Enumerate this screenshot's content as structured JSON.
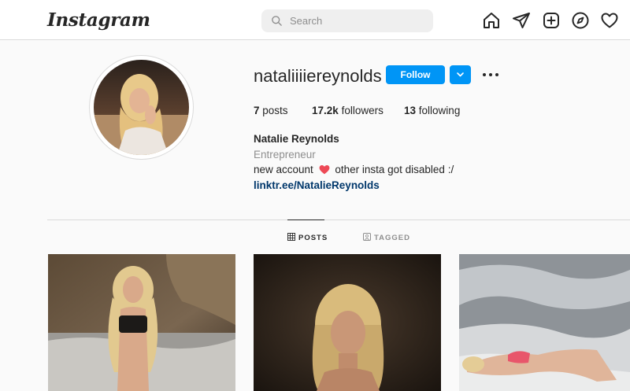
{
  "header": {
    "logo": "Instagram",
    "search_placeholder": "Search",
    "nav_icons": [
      "home-icon",
      "direct-message-icon",
      "new-post-icon",
      "explore-icon",
      "activity-heart-icon"
    ]
  },
  "profile": {
    "username": "nataliiiiereynolds",
    "follow_label": "Follow",
    "stats": {
      "posts_count": "7",
      "posts_label": "posts",
      "followers_count": "17.2k",
      "followers_label": "followers",
      "following_count": "13",
      "following_label": "following"
    },
    "full_name": "Natalie Reynolds",
    "category": "Entrepreneur",
    "bio_before_emoji": "new account",
    "bio_after_emoji": "other insta got disabled :/",
    "bio_emoji": "heart",
    "link": "linktr.ee/NatalieReynolds"
  },
  "tabs": [
    {
      "label": "POSTS",
      "active": true
    },
    {
      "label": "TAGGED",
      "active": false
    }
  ],
  "colors": {
    "accent": "#0095f6",
    "link": "#00376b",
    "muted": "#8e8e8e",
    "heart": "#ed4956"
  }
}
